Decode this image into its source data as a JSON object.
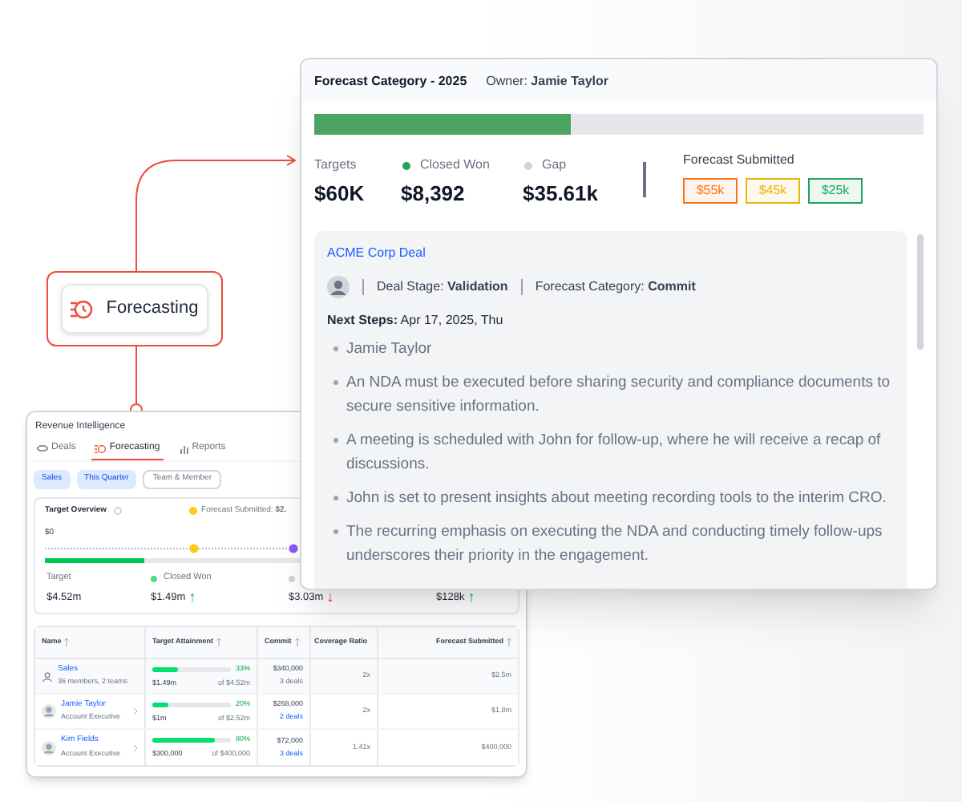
{
  "node": {
    "label": "Forecasting"
  },
  "revenue_window": {
    "title": "Revenue Intelligence",
    "tabs": [
      {
        "label": "Deals",
        "kind": "deals",
        "selected": false
      },
      {
        "label": "Forecasting",
        "kind": "forecast",
        "selected": true
      },
      {
        "label": "Reports",
        "kind": "reports",
        "selected": false
      }
    ],
    "filters": [
      {
        "label": "Sales",
        "selected": true
      },
      {
        "label": "This Quarter",
        "selected": true
      },
      {
        "label": "Team & Member",
        "selected": false
      }
    ],
    "overview": {
      "title": "Target Overview",
      "legend": "Forecast Submitted: **$2.**",
      "start": "$0",
      "level": 0.39,
      "stats": [
        {
          "label": "Target",
          "value": "$4.52m"
        },
        {
          "label": "Closed Won",
          "value": "$1.49m",
          "color": "#4ade80",
          "arrow": {
            "text": "↑",
            "rising": true
          }
        },
        {
          "value": "$3.03m",
          "color": "#d1d5db",
          "arrow": {
            "text": "↓",
            "rising": false
          }
        },
        {
          "value": "$128k",
          "arrow": {
            "text": "↑",
            "rising": true
          }
        }
      ]
    },
    "table": {
      "columns": [
        "Name",
        "Target Attainment",
        "Commit",
        "Coverage Ratio",
        "Forecast Submitted"
      ],
      "rows": [
        {
          "kind": "team",
          "name": "Sales",
          "subtitle": "36 members, 2 teams",
          "level": 0.33,
          "percent": "33%",
          "achieved": "$1.49m",
          "of": "of $4.52m",
          "commit": "$340,000",
          "deals": "3 deals",
          "coverage": "2x",
          "forecast": "$2.5m"
        },
        {
          "kind": "person",
          "name": "Jamie Taylor",
          "subtitle": "Account Executive",
          "level": 0.2,
          "percent": "20%",
          "achieved": "$1m",
          "of": "of $2.52m",
          "commit": "$268,000",
          "deals": "2 deals",
          "coverage": "2x",
          "forecast": "$1.8m"
        },
        {
          "kind": "person",
          "name": "Kim Fields",
          "subtitle": "Account Executive",
          "level": 0.8,
          "percent": "80%",
          "achieved": "$300,000",
          "of": "of $400,000",
          "commit": "$72,000",
          "deals": "3 deals",
          "coverage": "1.41x",
          "forecast": "$400,000"
        }
      ]
    }
  },
  "forecast_window": {
    "title": "Forecast Category - 2025",
    "owner": "Owner: **Jamie Taylor**",
    "level": 0.42,
    "stats": [
      {
        "label": "Targets",
        "value": "$60K"
      },
      {
        "label": "Closed Won",
        "value": "$8,392",
        "color": "#22a35a"
      },
      {
        "label": "Gap",
        "value": "$35.61k",
        "color": "#d1d5db"
      }
    ],
    "submitted_label": "Forecast Submitted",
    "chips": [
      {
        "label": "$55k",
        "color": "#f97316"
      },
      {
        "label": "$45k",
        "color": "#eab308"
      },
      {
        "label": "$25k",
        "color": "#22a35a"
      }
    ],
    "deal": {
      "title": "ACME Corp Deal",
      "stage": "Deal Stage: **Validation**",
      "category": "Forecast Category: **Commit**",
      "next_steps": "**Next Steps:** Apr 17, 2025, Thu",
      "bullets": [
        "Jamie Taylor",
        "An NDA must be executed before sharing security and compliance documents to secure sensitive information.",
        "A meeting is scheduled with John for follow-up, where he will receive a recap of discussions.",
        "John is set to present insights about meeting recording tools to the interim CRO.",
        "The recurring emphasis on executing the NDA and conducting timely follow-ups underscores their priority in the engagement."
      ]
    }
  }
}
